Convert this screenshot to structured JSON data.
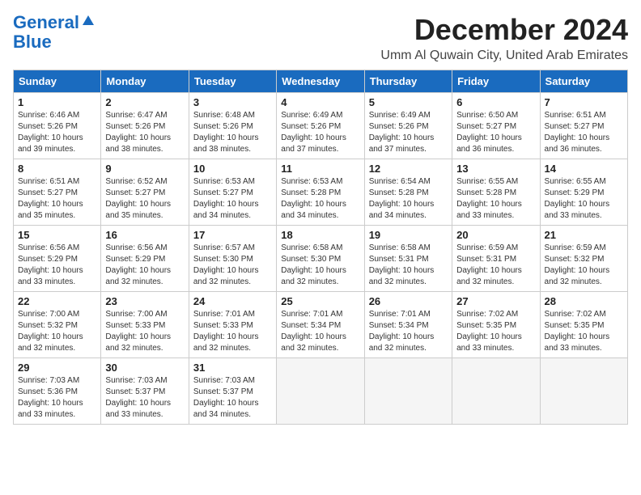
{
  "logo": {
    "line1": "General",
    "line2": "Blue"
  },
  "title": "December 2024",
  "subtitle": "Umm Al Quwain City, United Arab Emirates",
  "days_of_week": [
    "Sunday",
    "Monday",
    "Tuesday",
    "Wednesday",
    "Thursday",
    "Friday",
    "Saturday"
  ],
  "weeks": [
    [
      {
        "day": 1,
        "sunrise": "6:46 AM",
        "sunset": "5:26 PM",
        "daylight": "10 hours and 39 minutes."
      },
      {
        "day": 2,
        "sunrise": "6:47 AM",
        "sunset": "5:26 PM",
        "daylight": "10 hours and 38 minutes."
      },
      {
        "day": 3,
        "sunrise": "6:48 AM",
        "sunset": "5:26 PM",
        "daylight": "10 hours and 38 minutes."
      },
      {
        "day": 4,
        "sunrise": "6:49 AM",
        "sunset": "5:26 PM",
        "daylight": "10 hours and 37 minutes."
      },
      {
        "day": 5,
        "sunrise": "6:49 AM",
        "sunset": "5:26 PM",
        "daylight": "10 hours and 37 minutes."
      },
      {
        "day": 6,
        "sunrise": "6:50 AM",
        "sunset": "5:27 PM",
        "daylight": "10 hours and 36 minutes."
      },
      {
        "day": 7,
        "sunrise": "6:51 AM",
        "sunset": "5:27 PM",
        "daylight": "10 hours and 36 minutes."
      }
    ],
    [
      {
        "day": 8,
        "sunrise": "6:51 AM",
        "sunset": "5:27 PM",
        "daylight": "10 hours and 35 minutes."
      },
      {
        "day": 9,
        "sunrise": "6:52 AM",
        "sunset": "5:27 PM",
        "daylight": "10 hours and 35 minutes."
      },
      {
        "day": 10,
        "sunrise": "6:53 AM",
        "sunset": "5:27 PM",
        "daylight": "10 hours and 34 minutes."
      },
      {
        "day": 11,
        "sunrise": "6:53 AM",
        "sunset": "5:28 PM",
        "daylight": "10 hours and 34 minutes."
      },
      {
        "day": 12,
        "sunrise": "6:54 AM",
        "sunset": "5:28 PM",
        "daylight": "10 hours and 34 minutes."
      },
      {
        "day": 13,
        "sunrise": "6:55 AM",
        "sunset": "5:28 PM",
        "daylight": "10 hours and 33 minutes."
      },
      {
        "day": 14,
        "sunrise": "6:55 AM",
        "sunset": "5:29 PM",
        "daylight": "10 hours and 33 minutes."
      }
    ],
    [
      {
        "day": 15,
        "sunrise": "6:56 AM",
        "sunset": "5:29 PM",
        "daylight": "10 hours and 33 minutes."
      },
      {
        "day": 16,
        "sunrise": "6:56 AM",
        "sunset": "5:29 PM",
        "daylight": "10 hours and 32 minutes."
      },
      {
        "day": 17,
        "sunrise": "6:57 AM",
        "sunset": "5:30 PM",
        "daylight": "10 hours and 32 minutes."
      },
      {
        "day": 18,
        "sunrise": "6:58 AM",
        "sunset": "5:30 PM",
        "daylight": "10 hours and 32 minutes."
      },
      {
        "day": 19,
        "sunrise": "6:58 AM",
        "sunset": "5:31 PM",
        "daylight": "10 hours and 32 minutes."
      },
      {
        "day": 20,
        "sunrise": "6:59 AM",
        "sunset": "5:31 PM",
        "daylight": "10 hours and 32 minutes."
      },
      {
        "day": 21,
        "sunrise": "6:59 AM",
        "sunset": "5:32 PM",
        "daylight": "10 hours and 32 minutes."
      }
    ],
    [
      {
        "day": 22,
        "sunrise": "7:00 AM",
        "sunset": "5:32 PM",
        "daylight": "10 hours and 32 minutes."
      },
      {
        "day": 23,
        "sunrise": "7:00 AM",
        "sunset": "5:33 PM",
        "daylight": "10 hours and 32 minutes."
      },
      {
        "day": 24,
        "sunrise": "7:01 AM",
        "sunset": "5:33 PM",
        "daylight": "10 hours and 32 minutes."
      },
      {
        "day": 25,
        "sunrise": "7:01 AM",
        "sunset": "5:34 PM",
        "daylight": "10 hours and 32 minutes."
      },
      {
        "day": 26,
        "sunrise": "7:01 AM",
        "sunset": "5:34 PM",
        "daylight": "10 hours and 32 minutes."
      },
      {
        "day": 27,
        "sunrise": "7:02 AM",
        "sunset": "5:35 PM",
        "daylight": "10 hours and 33 minutes."
      },
      {
        "day": 28,
        "sunrise": "7:02 AM",
        "sunset": "5:35 PM",
        "daylight": "10 hours and 33 minutes."
      }
    ],
    [
      {
        "day": 29,
        "sunrise": "7:03 AM",
        "sunset": "5:36 PM",
        "daylight": "10 hours and 33 minutes."
      },
      {
        "day": 30,
        "sunrise": "7:03 AM",
        "sunset": "5:37 PM",
        "daylight": "10 hours and 33 minutes."
      },
      {
        "day": 31,
        "sunrise": "7:03 AM",
        "sunset": "5:37 PM",
        "daylight": "10 hours and 34 minutes."
      },
      null,
      null,
      null,
      null
    ]
  ]
}
